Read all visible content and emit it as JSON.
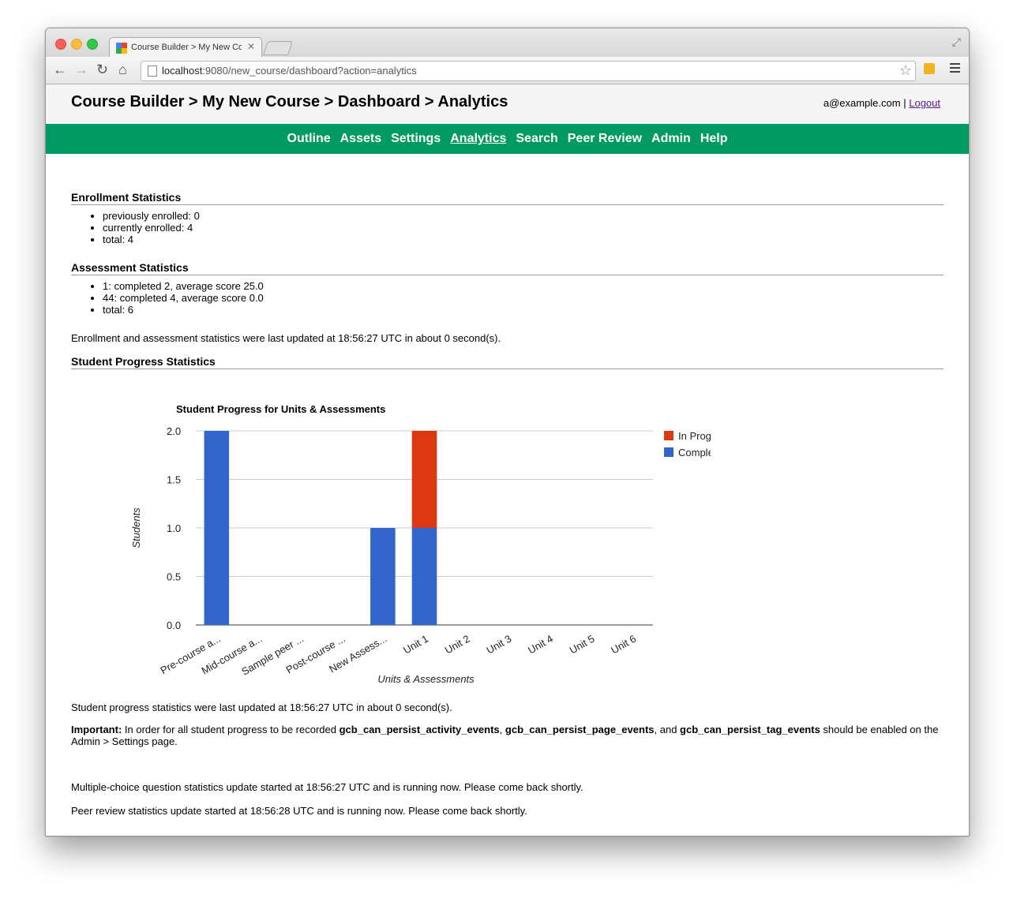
{
  "browser": {
    "tab_title": "Course Builder > My New Course",
    "url_host": "localhost",
    "url_rest": ":9080/new_course/dashboard?action=analytics"
  },
  "header": {
    "title": "Course Builder > My New Course > Dashboard > Analytics",
    "user_email": "a@example.com",
    "separator": "|",
    "logout_label": "Logout"
  },
  "nav": {
    "items": [
      "Outline",
      "Assets",
      "Settings",
      "Analytics",
      "Search",
      "Peer Review",
      "Admin",
      "Help"
    ],
    "active": "Analytics"
  },
  "enrollment": {
    "heading": "Enrollment Statistics",
    "items": [
      "previously enrolled: 0",
      "currently enrolled: 4",
      "total: 4"
    ]
  },
  "assessment": {
    "heading": "Assessment Statistics",
    "items": [
      "1: completed 2, average score 25.0",
      "44: completed 4, average score 0.0",
      "total: 6"
    ],
    "updated": "Enrollment and assessment statistics were last updated at 18:56:27 UTC in about 0 second(s)."
  },
  "progress": {
    "heading": "Student Progress Statistics",
    "updated": "Student progress statistics were last updated at 18:56:27 UTC in about 0 second(s).",
    "important_label": "Important:",
    "important_text_1": " In order for all student progress to be recorded ",
    "event_1": "gcb_can_persist_activity_events",
    "sep_1": ", ",
    "event_2": "gcb_can_persist_page_events",
    "sep_2": ", and ",
    "event_3": "gcb_can_persist_tag_events",
    "important_text_2": " should be enabled on the Admin > Settings page."
  },
  "mcq_status": "Multiple-choice question statistics update started at 18:56:27 UTC and is running now. Please come back shortly.",
  "peer_status": "Peer review statistics update started at 18:56:28 UTC and is running now. Please come back shortly.",
  "chart_data": {
    "type": "bar",
    "stacked": true,
    "title": "Student Progress for Units & Assessments",
    "xlabel": "Units & Assessments",
    "ylabel": "Students",
    "ylim": [
      0,
      2
    ],
    "yticks": [
      "0.0",
      "0.5",
      "1.0",
      "1.5",
      "2.0"
    ],
    "categories": [
      "Pre-course a...",
      "Mid-course a...",
      "Sample peer ...",
      "Post-course ...",
      "New Assess...",
      "Unit 1",
      "Unit 2",
      "Unit 3",
      "Unit 4",
      "Unit 5",
      "Unit 6"
    ],
    "series": [
      {
        "name": "Completed",
        "color": "#3366cc",
        "values": [
          2,
          0,
          0,
          0,
          1,
          1,
          0,
          0,
          0,
          0,
          0
        ]
      },
      {
        "name": "In Progress",
        "color": "#dc3912",
        "values": [
          0,
          0,
          0,
          0,
          0,
          1,
          0,
          0,
          0,
          0,
          0
        ]
      }
    ],
    "legend": "right"
  }
}
